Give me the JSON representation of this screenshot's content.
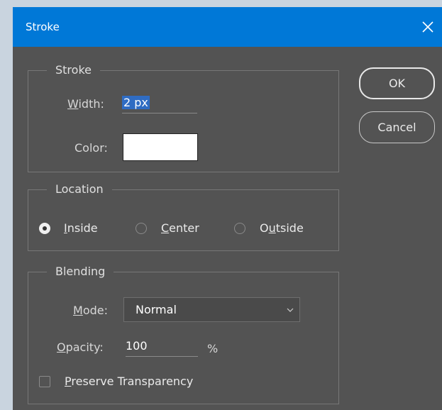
{
  "window": {
    "title": "Stroke"
  },
  "stroke_group": {
    "legend": "Stroke",
    "width_label_u": "W",
    "width_label_rest": "idth:",
    "width_value": "2 px",
    "color_label": "Color:",
    "color_value": "#ffffff"
  },
  "location_group": {
    "legend": "Location",
    "options": [
      {
        "underline": "I",
        "rest": "nside",
        "checked": true
      },
      {
        "underline": "C",
        "rest": "enter",
        "checked": false
      },
      {
        "pre": "O",
        "underline": "u",
        "rest": "tside",
        "checked": false
      }
    ]
  },
  "blending_group": {
    "legend": "Blending",
    "mode_label_u": "M",
    "mode_label_rest": "ode:",
    "mode_value": "Normal",
    "opacity_label_u": "O",
    "opacity_label_rest": "pacity:",
    "opacity_value": "100",
    "opacity_unit": "%",
    "preserve_u": "P",
    "preserve_rest": "reserve Transparency",
    "preserve_checked": false
  },
  "buttons": {
    "ok": "OK",
    "cancel": "Cancel"
  },
  "icons": {
    "close": "close-icon",
    "chevron": "chevron-down-icon"
  }
}
